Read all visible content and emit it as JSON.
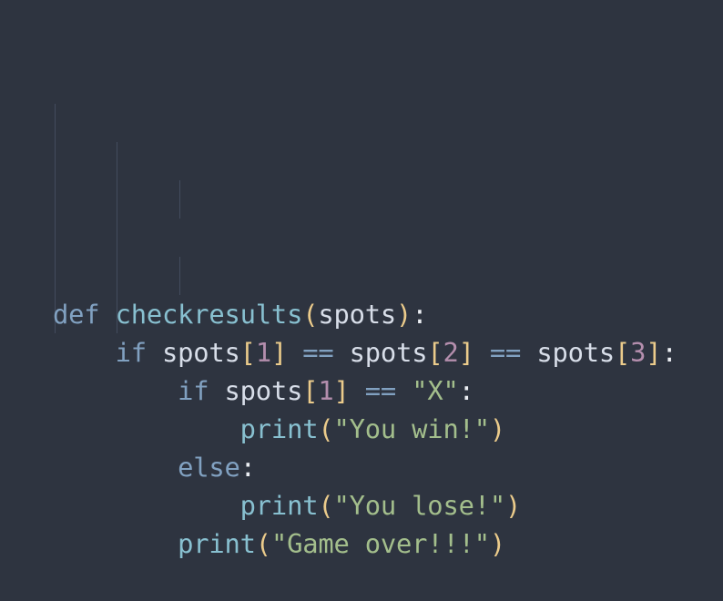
{
  "code": {
    "lines": [
      {
        "indent": "",
        "tokens": [
          {
            "t": "def",
            "c": "kw"
          },
          {
            "t": " ",
            "c": "id"
          },
          {
            "t": "checkresults",
            "c": "fn"
          },
          {
            "t": "(",
            "c": "br"
          },
          {
            "t": "spots",
            "c": "id"
          },
          {
            "t": ")",
            "c": "br"
          },
          {
            "t": ":",
            "c": "pn"
          }
        ]
      },
      {
        "indent": "    ",
        "tokens": [
          {
            "t": "if",
            "c": "kw"
          },
          {
            "t": " spots",
            "c": "id"
          },
          {
            "t": "[",
            "c": "br"
          },
          {
            "t": "1",
            "c": "num"
          },
          {
            "t": "]",
            "c": "br"
          },
          {
            "t": " ",
            "c": "id"
          },
          {
            "t": "==",
            "c": "op"
          },
          {
            "t": " spots",
            "c": "id"
          },
          {
            "t": "[",
            "c": "br"
          },
          {
            "t": "2",
            "c": "num"
          },
          {
            "t": "]",
            "c": "br"
          },
          {
            "t": " ",
            "c": "id"
          },
          {
            "t": "==",
            "c": "op"
          },
          {
            "t": " spots",
            "c": "id"
          },
          {
            "t": "[",
            "c": "br"
          },
          {
            "t": "3",
            "c": "num"
          },
          {
            "t": "]",
            "c": "br"
          },
          {
            "t": ":",
            "c": "pn"
          }
        ]
      },
      {
        "indent": "        ",
        "tokens": [
          {
            "t": "if",
            "c": "kw"
          },
          {
            "t": " spots",
            "c": "id"
          },
          {
            "t": "[",
            "c": "br"
          },
          {
            "t": "1",
            "c": "num"
          },
          {
            "t": "]",
            "c": "br"
          },
          {
            "t": " ",
            "c": "id"
          },
          {
            "t": "==",
            "c": "op"
          },
          {
            "t": " ",
            "c": "id"
          },
          {
            "t": "\"X\"",
            "c": "str"
          },
          {
            "t": ":",
            "c": "pn"
          }
        ]
      },
      {
        "indent": "            ",
        "tokens": [
          {
            "t": "print",
            "c": "fn"
          },
          {
            "t": "(",
            "c": "br"
          },
          {
            "t": "\"You win!\"",
            "c": "str"
          },
          {
            "t": ")",
            "c": "br"
          }
        ]
      },
      {
        "indent": "        ",
        "tokens": [
          {
            "t": "else",
            "c": "kw"
          },
          {
            "t": ":",
            "c": "pn"
          }
        ]
      },
      {
        "indent": "            ",
        "tokens": [
          {
            "t": "print",
            "c": "fn"
          },
          {
            "t": "(",
            "c": "br"
          },
          {
            "t": "\"You lose!\"",
            "c": "str"
          },
          {
            "t": ")",
            "c": "br"
          }
        ]
      },
      {
        "indent": "        ",
        "tokens": [
          {
            "t": "print",
            "c": "fn"
          },
          {
            "t": "(",
            "c": "br"
          },
          {
            "t": "\"Game over!!!\"",
            "c": "str"
          },
          {
            "t": ")",
            "c": "br"
          }
        ]
      }
    ]
  },
  "theme": {
    "background": "#2e3440",
    "keyword": "#81a1c1",
    "function": "#88c0d0",
    "identifier": "#d8dee9",
    "bracket": "#ebcb8b",
    "number": "#b48ead",
    "string": "#a3be8c",
    "indent_guide": "#434c5e"
  }
}
